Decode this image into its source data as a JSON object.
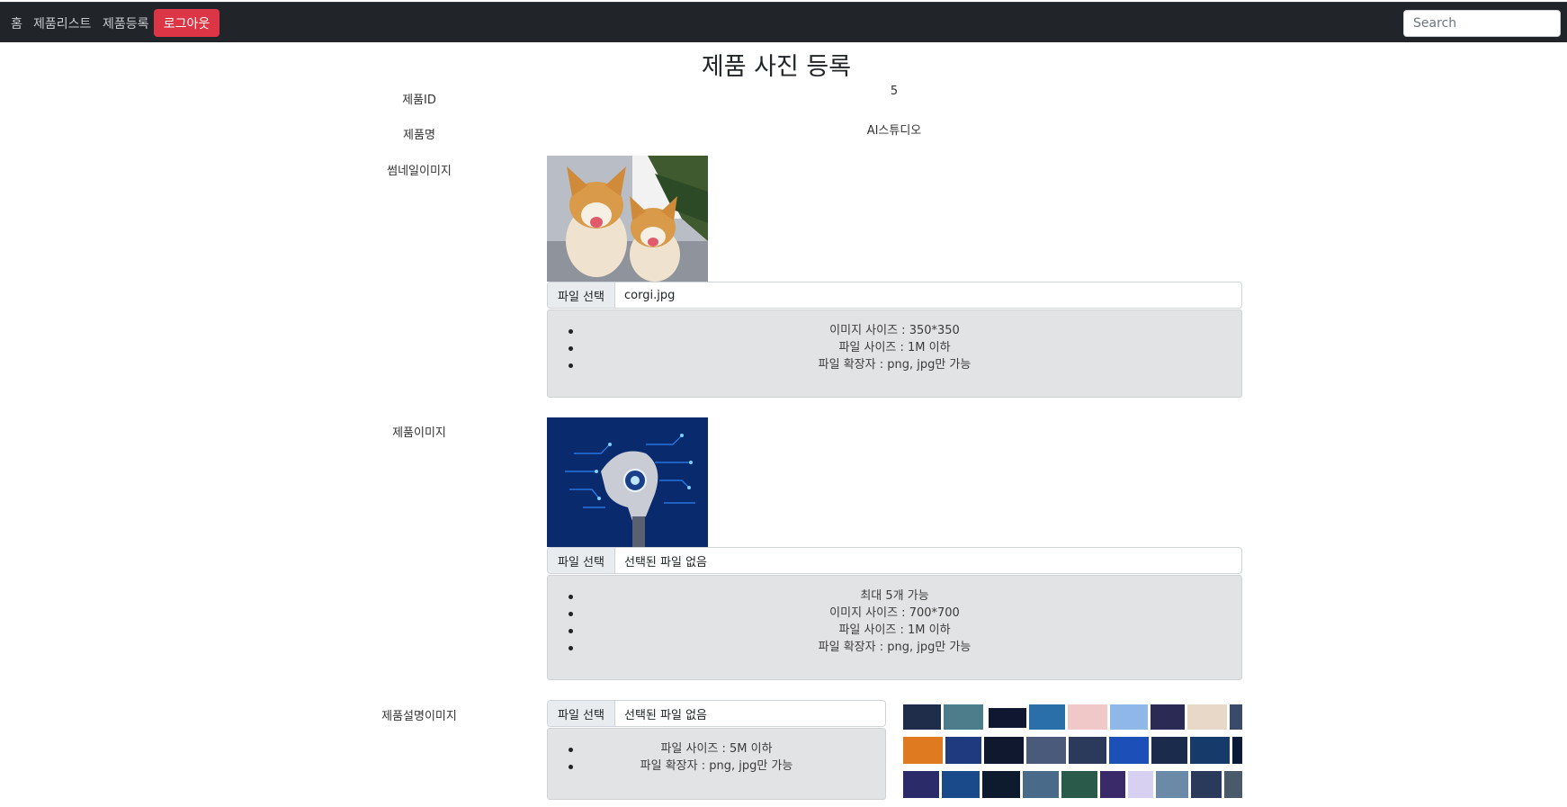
{
  "nav": {
    "home": "홈",
    "product_list": "제품리스트",
    "product_register": "제품등록",
    "logout": "로그아웃",
    "search_placeholder": "Search"
  },
  "page": {
    "title": "제품 사진 등록"
  },
  "product": {
    "id_label": "제품ID",
    "id_value": "5",
    "name_label": "제품명",
    "name_value": "AI스튜디오"
  },
  "thumbnail": {
    "label": "썸네일이미지",
    "file_button": "파일 선택",
    "file_name": "corgi.jpg",
    "rules": [
      "이미지 사이즈 : 350*350",
      "파일 사이즈 : 1M 이하",
      "파일 확장자 : png, jpg만 가능"
    ]
  },
  "product_image": {
    "label": "제품이미지",
    "file_button": "파일 선택",
    "file_name": "선택된 파일 없음",
    "rules": [
      "최대 5개 가능",
      "이미지 사이즈 : 700*700",
      "파일 사이즈 : 1M 이하",
      "파일 확장자 : png, jpg만 가능"
    ]
  },
  "description_image": {
    "label": "제품설명이미지",
    "file_button": "파일 선택",
    "file_name": "선택된 파일 없음",
    "rules": [
      "파일 사이즈 : 5M 이하",
      "파일 확장자 : png, jpg만 가능"
    ]
  },
  "colors": {
    "navbar": "#212529",
    "logout": "#dc3545",
    "info_box": "#e2e3e5"
  }
}
